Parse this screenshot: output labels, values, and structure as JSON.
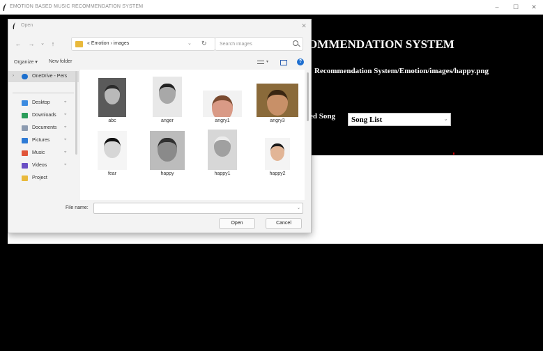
{
  "app": {
    "title": "EMOTION BASED MUSIC RECOMMENDATION SYSTEM",
    "window_controls": {
      "minimize": "–",
      "maximize": "☐",
      "close": "✕"
    },
    "heading": "OMMENDATION SYSTEM",
    "image_path": "Recommendation System/Emotion/images/happy.png",
    "song_label": "ed Song",
    "song_select": {
      "value": "Song List",
      "arrow": "⌄"
    }
  },
  "dialog": {
    "title": "Open",
    "close": "✕",
    "nav": {
      "back": "←",
      "forward": "→",
      "recent": "⌄",
      "up": "↑"
    },
    "address": {
      "path": "« Emotion › images",
      "dropdown": "⌄",
      "refresh": "↻"
    },
    "search": {
      "placeholder": "Search images"
    },
    "toolbar": {
      "organize": "Organize ▾",
      "new_folder": "New folder",
      "view_dropdown": "▾",
      "help": "?"
    },
    "sidebar": [
      {
        "label": "OneDrive - Pers",
        "icon": "onedrive-icon",
        "color": "#1c6fce"
      },
      {
        "label": "Desktop",
        "icon": "desktop-icon",
        "color": "#3c8be0"
      },
      {
        "label": "Downloads",
        "icon": "downloads-icon",
        "color": "#2a9d5a"
      },
      {
        "label": "Documents",
        "icon": "documents-icon",
        "color": "#8c9bb0"
      },
      {
        "label": "Pictures",
        "icon": "pictures-icon",
        "color": "#2e7bd6"
      },
      {
        "label": "Music",
        "icon": "music-icon",
        "color": "#e0553a"
      },
      {
        "label": "Videos",
        "icon": "videos-icon",
        "color": "#6a4fc4"
      },
      {
        "label": "Project",
        "icon": "folder-icon",
        "color": "#e9b93b"
      }
    ],
    "sidebar_pin": "⌖",
    "sidebar_chevron": "›",
    "files": [
      {
        "label": "abc",
        "thumb": "grayscale-face-photo"
      },
      {
        "label": "anger",
        "thumb": "grayscale-face-photo"
      },
      {
        "label": "angry1",
        "thumb": "color-face-photo"
      },
      {
        "label": "angry3",
        "thumb": "color-face-photo"
      },
      {
        "label": "fear",
        "thumb": "grayscale-face-photo"
      },
      {
        "label": "happy",
        "thumb": "grayscale-face-photo"
      },
      {
        "label": "happy1",
        "thumb": "grayscale-face-photo"
      },
      {
        "label": "happy2",
        "thumb": "color-face-photo"
      },
      {
        "label": "",
        "thumb": "color-face-photo"
      },
      {
        "label": "",
        "thumb": "grayscale-face-photo"
      },
      {
        "label": "",
        "thumb": "color-face-photo"
      },
      {
        "label": "",
        "thumb": "color-face-photo"
      }
    ],
    "filename": {
      "label": "File name:",
      "value": "",
      "dropdown": "⌄"
    },
    "buttons": {
      "open": "Open",
      "cancel": "Cancel"
    }
  }
}
